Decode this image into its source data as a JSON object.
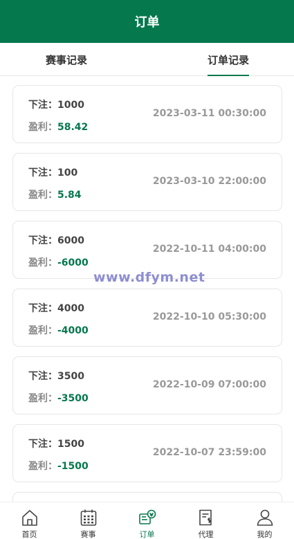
{
  "header": {
    "title": "订单"
  },
  "tabs": [
    {
      "label": "赛事记录",
      "active": false
    },
    {
      "label": "订单记录",
      "active": true
    }
  ],
  "orders": [
    {
      "bet_label": "下注：",
      "bet": "1000",
      "profit_label": "盈利：",
      "profit": "58.42",
      "time": "2023-03-11 00:30:00"
    },
    {
      "bet_label": "下注：",
      "bet": "100",
      "profit_label": "盈利：",
      "profit": "5.84",
      "time": "2023-03-10 22:00:00"
    },
    {
      "bet_label": "下注：",
      "bet": "6000",
      "profit_label": "盈利：",
      "profit": "-6000",
      "time": "2022-10-11 04:00:00"
    },
    {
      "bet_label": "下注：",
      "bet": "4000",
      "profit_label": "盈利：",
      "profit": "-4000",
      "time": "2022-10-10 05:30:00"
    },
    {
      "bet_label": "下注：",
      "bet": "3500",
      "profit_label": "盈利：",
      "profit": "-3500",
      "time": "2022-10-09 07:00:00"
    },
    {
      "bet_label": "下注：",
      "bet": "1500",
      "profit_label": "盈利：",
      "profit": "-1500",
      "time": "2022-10-07 23:59:00"
    },
    {
      "bet_label": "",
      "bet": "",
      "profit_label": "",
      "profit": "",
      "time": ""
    }
  ],
  "watermark": "www.dfym.net",
  "nav": [
    {
      "label": "首页",
      "icon": "home-icon"
    },
    {
      "label": "赛事",
      "icon": "calendar-icon"
    },
    {
      "label": "订单",
      "icon": "order-icon"
    },
    {
      "label": "代理",
      "icon": "agent-icon"
    },
    {
      "label": "我的",
      "icon": "user-icon"
    }
  ],
  "colors": {
    "brand": "#06784d",
    "profit": "#06784d",
    "muted": "#999999"
  }
}
